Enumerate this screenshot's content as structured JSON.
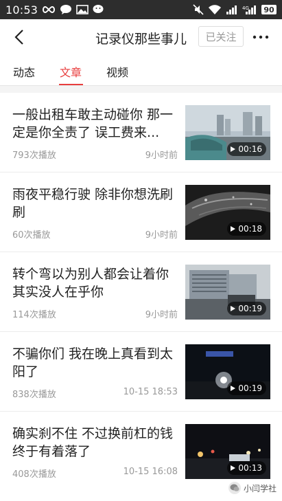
{
  "status_bar": {
    "time": "10:53",
    "battery": "90",
    "left_icons": [
      "infinity-icon",
      "chat-bubble-icon",
      "image-icon",
      "wechat-icon"
    ],
    "right_icons": [
      "mute-icon",
      "wifi-icon",
      "signal-icon",
      "signal-4g-icon",
      "battery-icon"
    ]
  },
  "nav": {
    "title": "记录仪那些事儿",
    "follow_label": "已关注"
  },
  "tabs": [
    {
      "label": "动态",
      "active": false
    },
    {
      "label": "文章",
      "active": true
    },
    {
      "label": "视频",
      "active": false
    }
  ],
  "items": [
    {
      "title": "一般出租车敢主动碰你 那一定是你全责了 误工费来...",
      "plays": "793次播放",
      "time": "9小时前",
      "duration": "00:16",
      "thumb": "taxi-road"
    },
    {
      "title": "雨夜平稳行驶 除非你想洗刷刷",
      "plays": "60次播放",
      "time": "9小时前",
      "duration": "00:18",
      "thumb": "rainy-night"
    },
    {
      "title": "转个弯以为别人都会让着你 其实没人在乎你",
      "plays": "114次播放",
      "time": "9小时前",
      "duration": "00:19",
      "thumb": "hospital-turn"
    },
    {
      "title": "不骗你们 我在晚上真看到太阳了",
      "plays": "838次播放",
      "time": "10-15 18:53",
      "duration": "00:19",
      "thumb": "night-light"
    },
    {
      "title": "确实刹不住 不过换前杠的钱终于有着落了",
      "plays": "408次播放",
      "time": "10-15 16:08",
      "duration": "00:13",
      "thumb": "night-street"
    }
  ],
  "watermark": "小闫学社",
  "colors": {
    "accent": "#e83e3e",
    "status_bar": "#2d2d2d",
    "muted": "#999999"
  }
}
